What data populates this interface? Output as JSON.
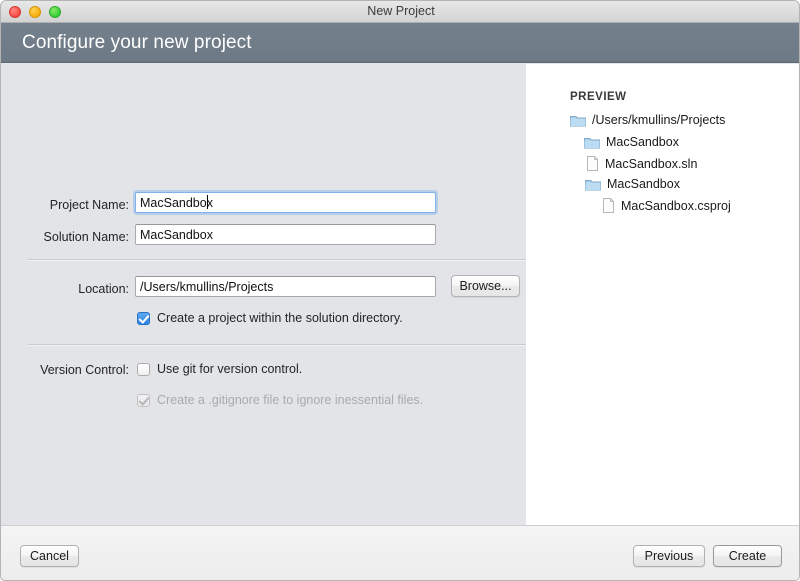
{
  "window": {
    "title": "New Project",
    "traffic_lights": [
      "close",
      "minimize",
      "maximize"
    ]
  },
  "banner": {
    "title": "Configure your new project"
  },
  "form": {
    "project_name": {
      "label": "Project Name:",
      "value": "MacSandbox",
      "focused": true
    },
    "solution_name": {
      "label": "Solution Name:",
      "value": "MacSandbox",
      "focused": false
    },
    "location": {
      "label": "Location:",
      "value": "/Users/kmullins/Projects",
      "browse_label": "Browse..."
    },
    "solution_dir_checkbox": {
      "label": "Create a project within the solution directory.",
      "checked": true,
      "disabled": false
    },
    "version_control": {
      "label": "Version Control:",
      "use_git": {
        "label": "Use git for version control.",
        "checked": false,
        "disabled": false
      },
      "gitignore": {
        "label": "Create a .gitignore file to ignore inessential files.",
        "checked": true,
        "disabled": true
      }
    }
  },
  "preview": {
    "title": "PREVIEW",
    "tree": [
      {
        "label": "/Users/kmullins/Projects",
        "type": "folder",
        "depth": 0
      },
      {
        "label": "MacSandbox",
        "type": "folder",
        "depth": 1
      },
      {
        "label": "MacSandbox.sln",
        "type": "file",
        "depth": 2
      },
      {
        "label": "MacSandbox",
        "type": "folder",
        "depth": 2
      },
      {
        "label": "MacSandbox.csproj",
        "type": "file",
        "depth": 3
      }
    ]
  },
  "footer": {
    "cancel_label": "Cancel",
    "previous_label": "Previous",
    "create_label": "Create"
  },
  "colors": {
    "banner": "#6d7985",
    "accent": "#2f83e0",
    "body": "#e2e4e8",
    "preview_bg": "#ffffff"
  }
}
